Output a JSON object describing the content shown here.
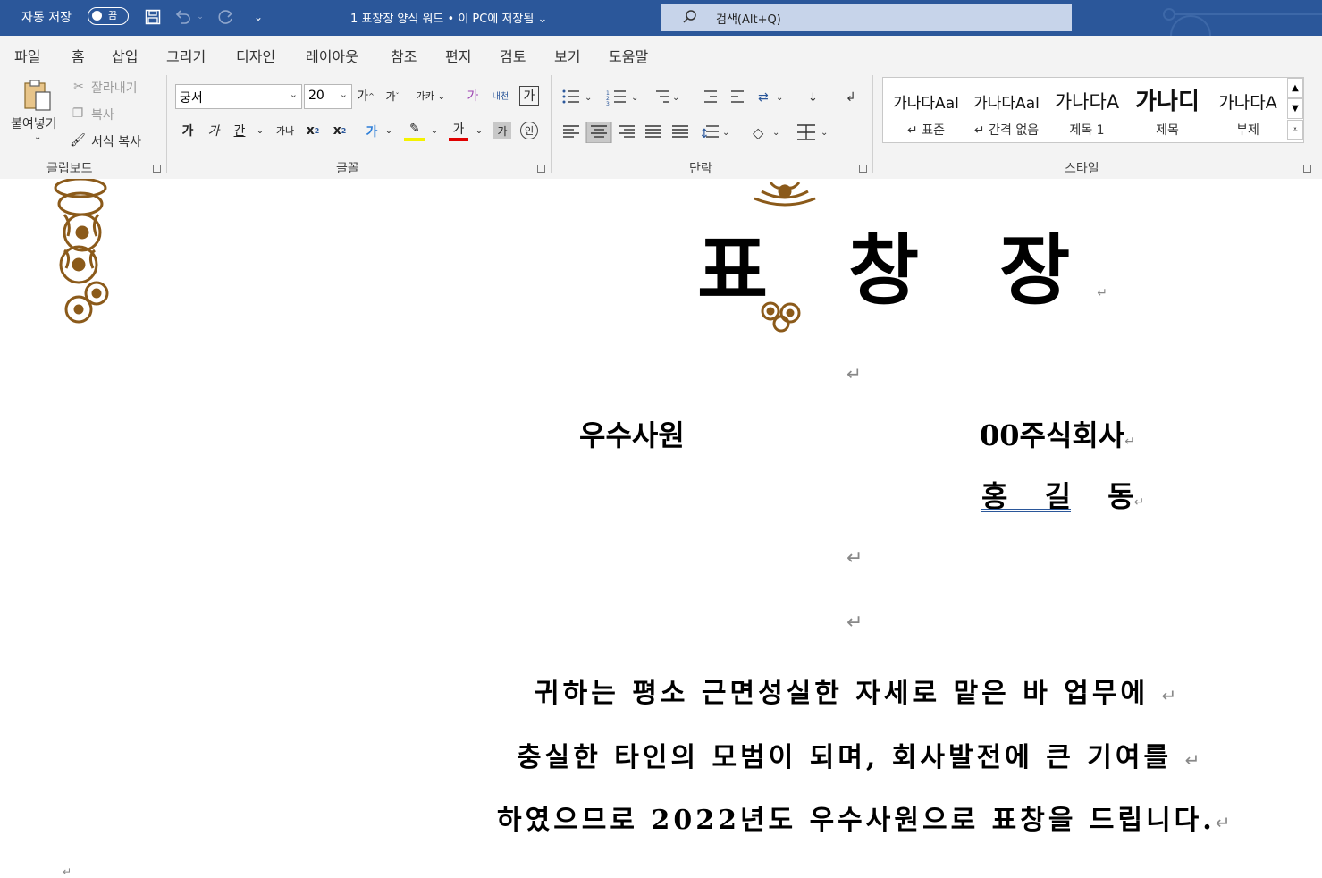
{
  "titlebar": {
    "autosave_label": "자동 저장",
    "autosave_state": "끔",
    "document_title": "1 표창장 양식 워드 • 이 PC에 저장됨",
    "search_placeholder": "검색(Alt+Q)"
  },
  "tabs": [
    "파일",
    "홈",
    "삽입",
    "그리기",
    "디자인",
    "레이아웃",
    "참조",
    "편지",
    "검토",
    "보기",
    "도움말"
  ],
  "active_tab": "홈",
  "ribbon": {
    "clipboard": {
      "label": "클립보드",
      "paste": "붙여넣기",
      "cut": "잘라내기",
      "copy": "복사",
      "format_painter": "서식 복사"
    },
    "font": {
      "label": "글꼴",
      "font_name": "궁서",
      "font_size": "20"
    },
    "paragraph": {
      "label": "단락"
    },
    "styles": {
      "label": "스타일",
      "items": [
        {
          "sample": "가나다Aal",
          "name": "↵ 표준"
        },
        {
          "sample": "가나다Aal",
          "name": "↵ 간격 없음"
        },
        {
          "sample": "가나다A",
          "name": "제목 1"
        },
        {
          "sample": "가나디",
          "name": "제목"
        },
        {
          "sample": "가나다A",
          "name": "부제"
        }
      ]
    }
  },
  "document": {
    "title": "표 창 장",
    "award": "우수사원",
    "company": "00주식회사",
    "ceo_name": "홍 길 동",
    "body_lines": [
      "귀하는 평소 근면성실한 자세로 맡은 바 업무에",
      "충실한 타인의 모범이 되며, 회사발전에 큰 기여를",
      "하였으므로 2022년도 우수사원으로 표창을 드립니다."
    ],
    "return_mark": "↵"
  },
  "colors": {
    "titlebar": "#2b579a",
    "ribbon": "#f3f3f3",
    "flower": "#8b5a1a"
  }
}
